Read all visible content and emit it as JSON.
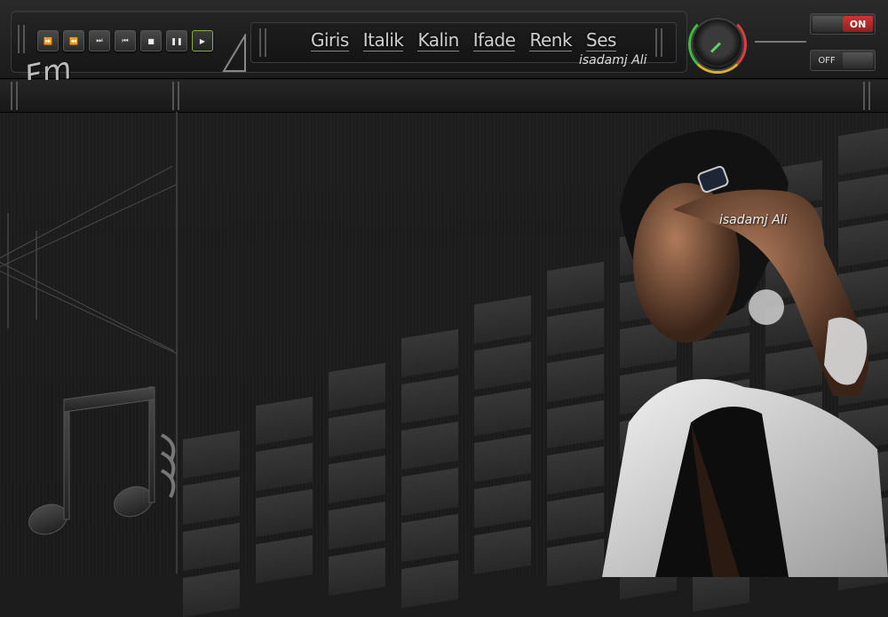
{
  "header": {
    "logo_text": "Fm",
    "menu": [
      "Giris",
      "Italik",
      "Kalin",
      "Ifade",
      "Renk",
      "Ses"
    ],
    "author": "isadamj Ali",
    "transport": [
      {
        "name": "fast-forward",
        "glyph": "⏩"
      },
      {
        "name": "rewind",
        "glyph": "⏪"
      },
      {
        "name": "next",
        "glyph": "⏭"
      },
      {
        "name": "previous",
        "glyph": "⏮"
      },
      {
        "name": "stop",
        "glyph": "■"
      },
      {
        "name": "pause",
        "glyph": "❚❚"
      },
      {
        "name": "play",
        "glyph": "▶"
      }
    ],
    "switch_on_label": "ON",
    "switch_off_label": "OFF"
  },
  "photo": {
    "watermark": "isadamj Ali"
  },
  "colors": {
    "accent_red": "#d23232",
    "knob_green": "#3bbf3b",
    "knob_yellow": "#d9b02a",
    "play_border": "#8ab04a"
  },
  "icons": [
    "music-note-icon",
    "speaker-icon",
    "volume-knob-icon"
  ]
}
